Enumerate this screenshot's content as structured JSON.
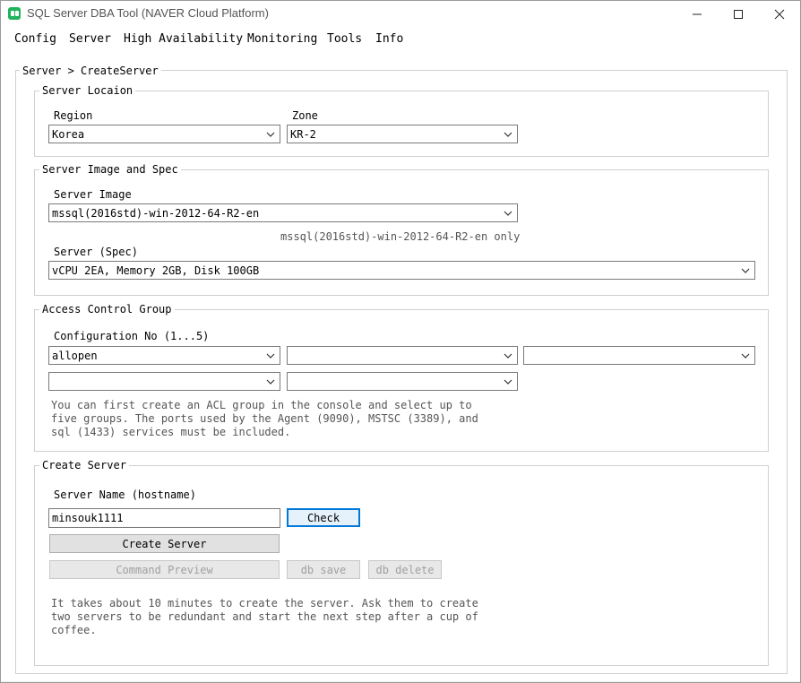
{
  "window": {
    "title": "SQL Server DBA Tool (NAVER Cloud Platform)"
  },
  "menu": [
    "Config",
    "Server",
    "High Availability",
    "Monitoring",
    "Tools",
    "Info"
  ],
  "breadcrumb": "Server > CreateServer",
  "location": {
    "legend": "Server Locaion",
    "region_label": "Region",
    "region_value": "Korea",
    "zone_label": "Zone",
    "zone_value": "KR-2"
  },
  "image_spec": {
    "legend": "Server Image and Spec",
    "image_label": "Server Image",
    "image_value": "mssql(2016std)-win-2012-64-R2-en",
    "image_note": "mssql(2016std)-win-2012-64-R2-en only",
    "spec_label": "Server (Spec)",
    "spec_value": "vCPU 2EA, Memory 2GB, Disk 100GB"
  },
  "acg": {
    "legend": "Access Control Group",
    "config_label": "Configuration No (1...5)",
    "slots": [
      "allopen",
      "",
      "",
      "",
      ""
    ],
    "hint": [
      "You can first create an ACL group in the console and select up to",
      "five groups. The ports used by the Agent (9090), MSTSC (3389), and",
      "sql (1433) services must be included."
    ]
  },
  "create": {
    "legend": "Create Server",
    "hostname_label": "Server Name (hostname)",
    "hostname_value": "minsouk1111",
    "check_label": "Check",
    "create_label": "Create Server",
    "preview_label": "Command Preview",
    "dbsave_label": "db save",
    "dbdelete_label": "db delete",
    "hint": [
      "It takes about 10 minutes to create the server. Ask them to create",
      "two servers to be redundant and start the next step after a cup of",
      "coffee."
    ]
  }
}
